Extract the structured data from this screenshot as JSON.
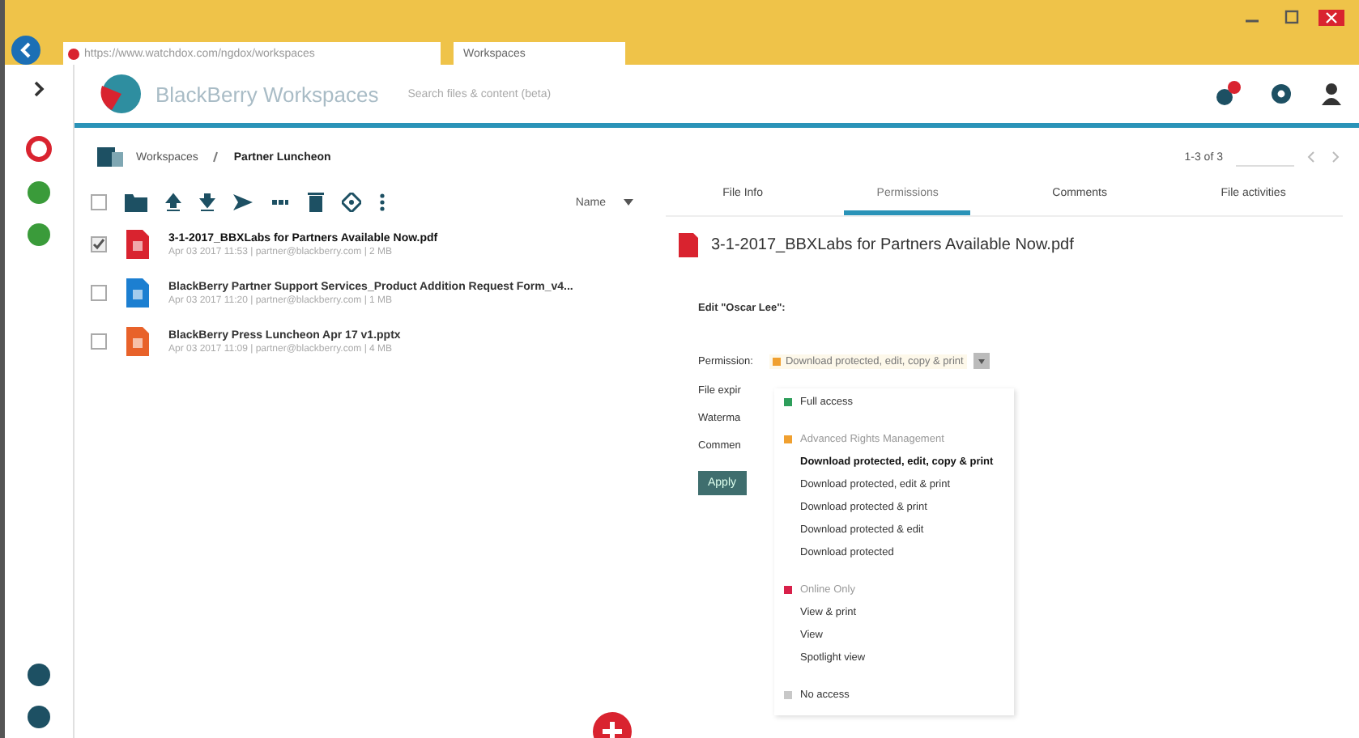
{
  "browser": {
    "url": "https://www.watchdox.com/ngdox/workspaces",
    "tab_title": "Workspaces"
  },
  "header": {
    "logo_text": "BlackBerry Workspaces",
    "search_placeholder": "Search files & content (beta)"
  },
  "breadcrumb": {
    "items": [
      "Workspaces",
      "Partner Luncheon"
    ],
    "pager": "1-3 of 3"
  },
  "file_list": {
    "sort_label": "Name",
    "all_checked": false,
    "files": [
      {
        "name": "3-1-2017_BBXLabs for Partners Available Now.pdf",
        "meta": "Apr 03 2017 11:53 | partner@blackberry.com | 2 MB",
        "kind": "pdf",
        "checked": true
      },
      {
        "name": "BlackBerry Partner Support Services_Product Addition Request Form_v4...",
        "meta": "Apr 03 2017 11:20 | partner@blackberry.com | 1 MB",
        "kind": "doc",
        "checked": false
      },
      {
        "name": "BlackBerry Press Luncheon Apr 17 v1.pptx",
        "meta": "Apr 03 2017 11:09 | partner@blackberry.com | 4 MB",
        "kind": "ppt",
        "checked": false
      }
    ]
  },
  "detail": {
    "tabs": [
      {
        "label": "File Info",
        "selected": false
      },
      {
        "label": "Permissions",
        "selected": true
      },
      {
        "label": "Comments",
        "selected": false
      },
      {
        "label": "File activities",
        "selected": false
      }
    ],
    "title": "3-1-2017_BBXLabs for Partners Available Now.pdf",
    "edit_label": "Edit \"Oscar Lee\":",
    "permission_label": "Permission:",
    "permission_value": "Download protected, edit, copy & print",
    "field_labels": [
      "File expir",
      "Waterma",
      "Commen"
    ],
    "apply": "Apply",
    "dropdown": [
      {
        "label": "Full access",
        "color": "#2e9e5b"
      },
      {
        "label": "Advanced Rights Management",
        "color": "#f0a030",
        "items": [
          {
            "label": "Download protected, edit, copy & print",
            "selected": true
          },
          {
            "label": "Download protected, edit & print",
            "selected": false
          },
          {
            "label": "Download protected & print",
            "selected": false
          },
          {
            "label": "Download protected & edit",
            "selected": false
          },
          {
            "label": "Download protected",
            "selected": false
          }
        ]
      },
      {
        "label": "Online Only",
        "color": "#d8204a",
        "items": [
          {
            "label": "View & print",
            "selected": false
          },
          {
            "label": "View",
            "selected": false
          },
          {
            "label": "Spotlight view",
            "selected": false
          }
        ]
      },
      {
        "label": "No access",
        "color": "#c8c8c8"
      }
    ]
  }
}
